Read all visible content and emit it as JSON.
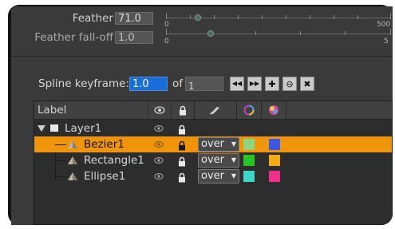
{
  "sliders": [
    {
      "label": "Feather",
      "value": "71.0",
      "min_label": "0",
      "max_label": "500",
      "level_fraction": 0.142,
      "dim": false
    },
    {
      "label": "Feather fall-off",
      "value": "1.0",
      "min_label": "0",
      "max_label": "5",
      "level_fraction": 0.2,
      "dim": true
    }
  ],
  "spline": {
    "label": "Spline keyframe:",
    "value": "1.0",
    "of_label": "of",
    "total": "1",
    "buttons": [
      {
        "name": "prev-keyframe-icon",
        "glyph": "◀◀"
      },
      {
        "name": "next-keyframe-icon",
        "glyph": "▶▶"
      },
      {
        "name": "add-keyframe-icon",
        "glyph": "✚"
      },
      {
        "name": "remove-keyframe-icon",
        "glyph": "⊖"
      },
      {
        "name": "clear-keyframes-icon",
        "glyph": "✖"
      }
    ]
  },
  "tree": {
    "header": {
      "label": "Label"
    },
    "rows": [
      {
        "label": "Layer1",
        "level": 0,
        "type": "layer",
        "selected": false,
        "blend": null,
        "overlay_color": null,
        "color": null
      },
      {
        "label": "Bezier1",
        "level": 1,
        "type": "shape",
        "selected": true,
        "blend": "over",
        "overlay_color": "#8fd47e",
        "color": "#3a57e6"
      },
      {
        "label": "Rectangle1",
        "level": 1,
        "type": "shape",
        "selected": false,
        "blend": "over",
        "overlay_color": "#27c427",
        "color": "#f4a81a"
      },
      {
        "label": "Ellipse1",
        "level": 1,
        "type": "shape",
        "selected": false,
        "blend": "over",
        "overlay_color": "#3fd6c9",
        "color": "#ef2f8b"
      }
    ]
  },
  "colors": {
    "selection": "#f0940a",
    "keyframe_input": "#1a6cd9",
    "panel_bg": "#3a3a3a"
  }
}
